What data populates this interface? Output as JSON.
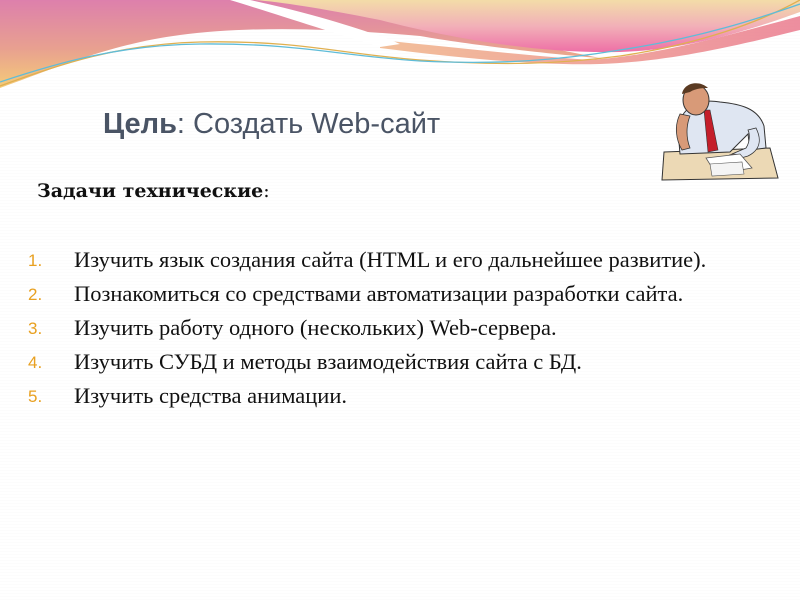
{
  "slide": {
    "title_bold": "Цель",
    "title_rest": ": Создать Web-сайт",
    "subtitle_bold": "Задачи технические",
    "subtitle_colon": ":",
    "tasks": [
      {
        "number": "1.",
        "text": "Изучить язык создания сайта (HTML и его дальнейшее развитие)."
      },
      {
        "number": "2.",
        "text": "Познакомиться со средствами автоматизации разработки сайта."
      },
      {
        "number": "3.",
        "text": "Изучить работу одного (нескольких) Web-сервера."
      },
      {
        "number": "4.",
        "text": "Изучить СУБД и методы взаимодействия сайта с БД."
      },
      {
        "number": "5.",
        "text": "Изучить средства анимации."
      }
    ],
    "clipart_icon": "tired-man-at-desk-icon"
  },
  "colors": {
    "title": "#4a5465",
    "list_number": "#e8a020",
    "wave_pink": "#e07fb0",
    "wave_orange": "#f0b878",
    "wave_line_blue": "#5fbcd8",
    "wave_line_gold": "#e0b050"
  }
}
